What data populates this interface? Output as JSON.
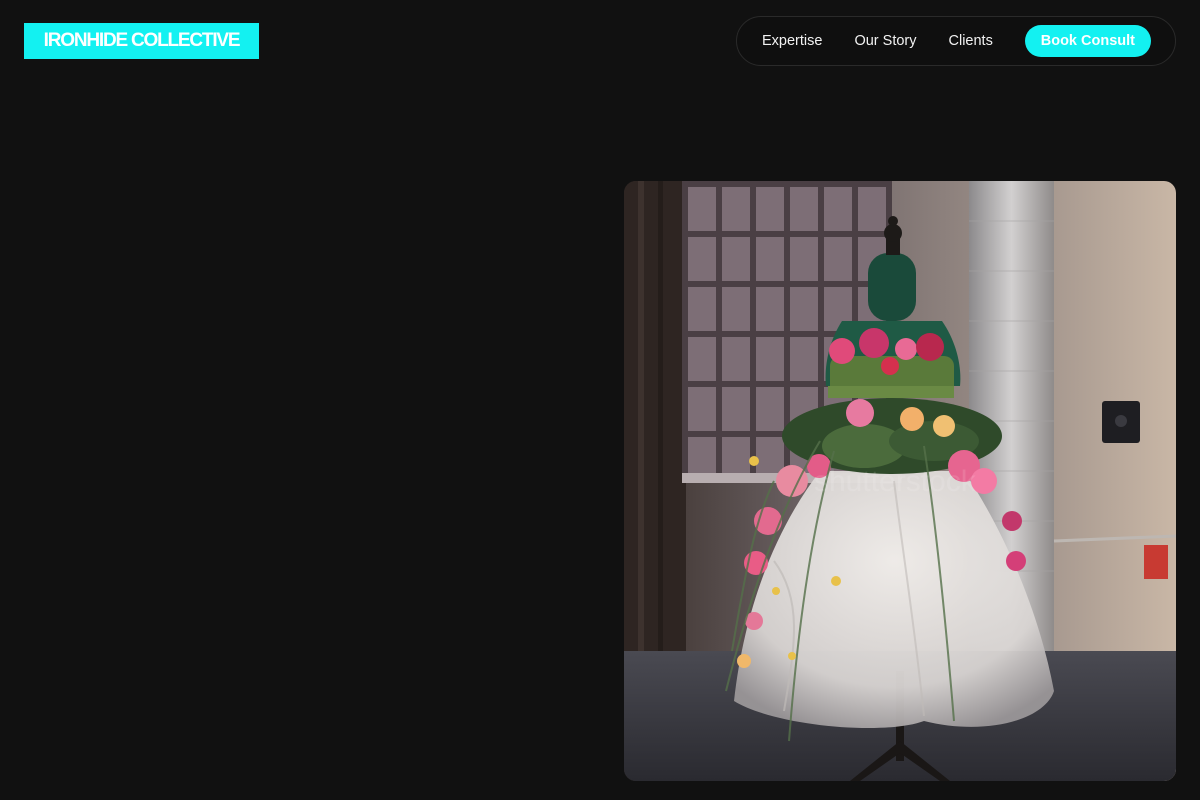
{
  "brand": {
    "logo_text": "IRONHIDE COLLECTIVE",
    "accent_color": "#13f1f1"
  },
  "nav": {
    "links": [
      {
        "label": "Expertise"
      },
      {
        "label": "Our Story"
      },
      {
        "label": "Clients"
      }
    ],
    "cta_label": "Book Consult"
  },
  "hero": {
    "image_subject": "floral-dress-mannequin-photo"
  },
  "colors": {
    "background": "#111111",
    "text": "#ffffff"
  }
}
